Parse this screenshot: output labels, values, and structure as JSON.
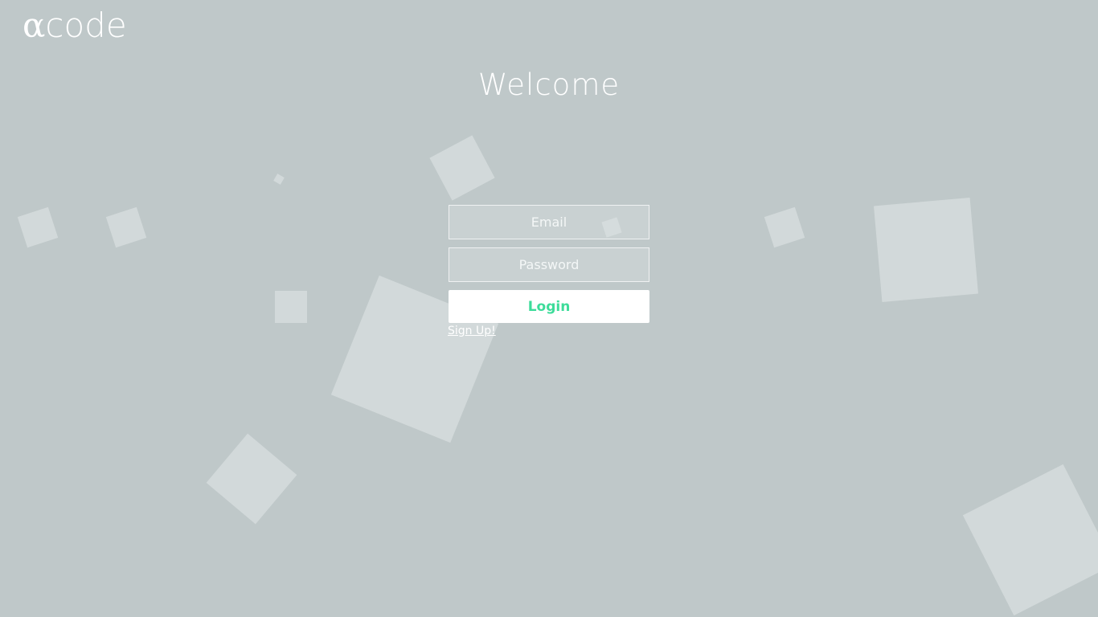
{
  "brand": {
    "alpha_glyph": "α",
    "name": "code"
  },
  "heading": "Welcome",
  "login_form": {
    "email_placeholder": "Email",
    "password_placeholder": "Password",
    "login_label": "Login",
    "signup_label": "Sign Up!"
  },
  "colors": {
    "background": "#bfc8c9",
    "login_text": "#3ddc9a",
    "text": "#ffffff"
  }
}
